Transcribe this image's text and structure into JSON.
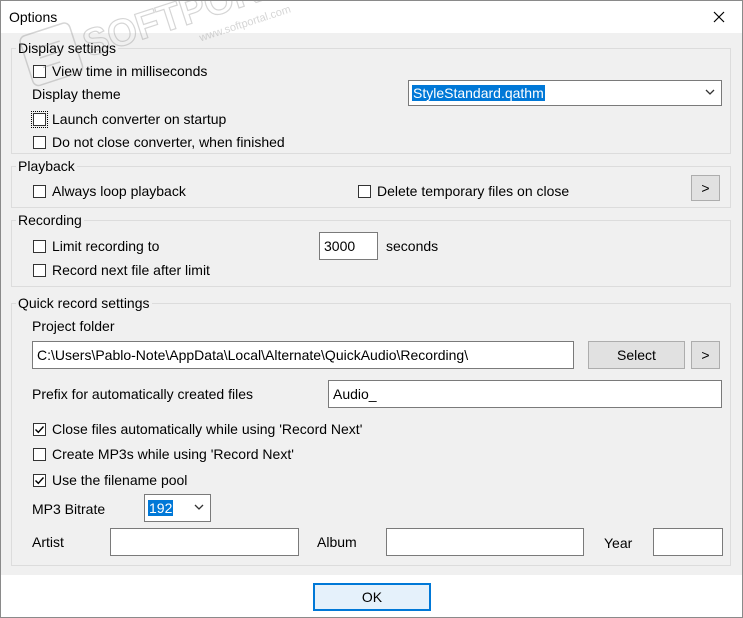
{
  "window": {
    "title": "Options"
  },
  "display": {
    "legend": "Display settings",
    "view_ms": "View time in milliseconds",
    "theme_label": "Display theme",
    "theme_value": "StyleStandard.qathm",
    "launch": "Launch converter on startup",
    "do_not_close": "Do not close converter, when finished"
  },
  "playback": {
    "legend": "Playback",
    "loop": "Always loop playback",
    "delete_temp": "Delete temporary files on close",
    "more": ">"
  },
  "recording": {
    "legend": "Recording",
    "limit": "Limit recording to",
    "limit_value": "3000",
    "seconds": "seconds",
    "next_after": "Record next file after limit"
  },
  "quick": {
    "legend": "Quick record settings",
    "project_folder_label": "Project folder",
    "project_folder": "C:\\Users\\Pablo-Note\\AppData\\Local\\Alternate\\QuickAudio\\Recording\\",
    "select": "Select",
    "more": ">",
    "prefix_label": "Prefix for automatically created files",
    "prefix_value": "Audio_",
    "close_files": "Close files automatically while using 'Record Next'",
    "create_mp3": "Create MP3s while using 'Record Next'",
    "use_pool": "Use the filename pool",
    "bitrate_label": "MP3 Bitrate",
    "bitrate_value": "192",
    "artist": "Artist",
    "album": "Album",
    "year": "Year",
    "checked": {
      "close_files": true,
      "create_mp3": false,
      "use_pool": true
    }
  },
  "footer": {
    "ok": "OK"
  },
  "watermark": {
    "text": "SOFTPORTAL",
    "url": "www.softportal.com"
  }
}
